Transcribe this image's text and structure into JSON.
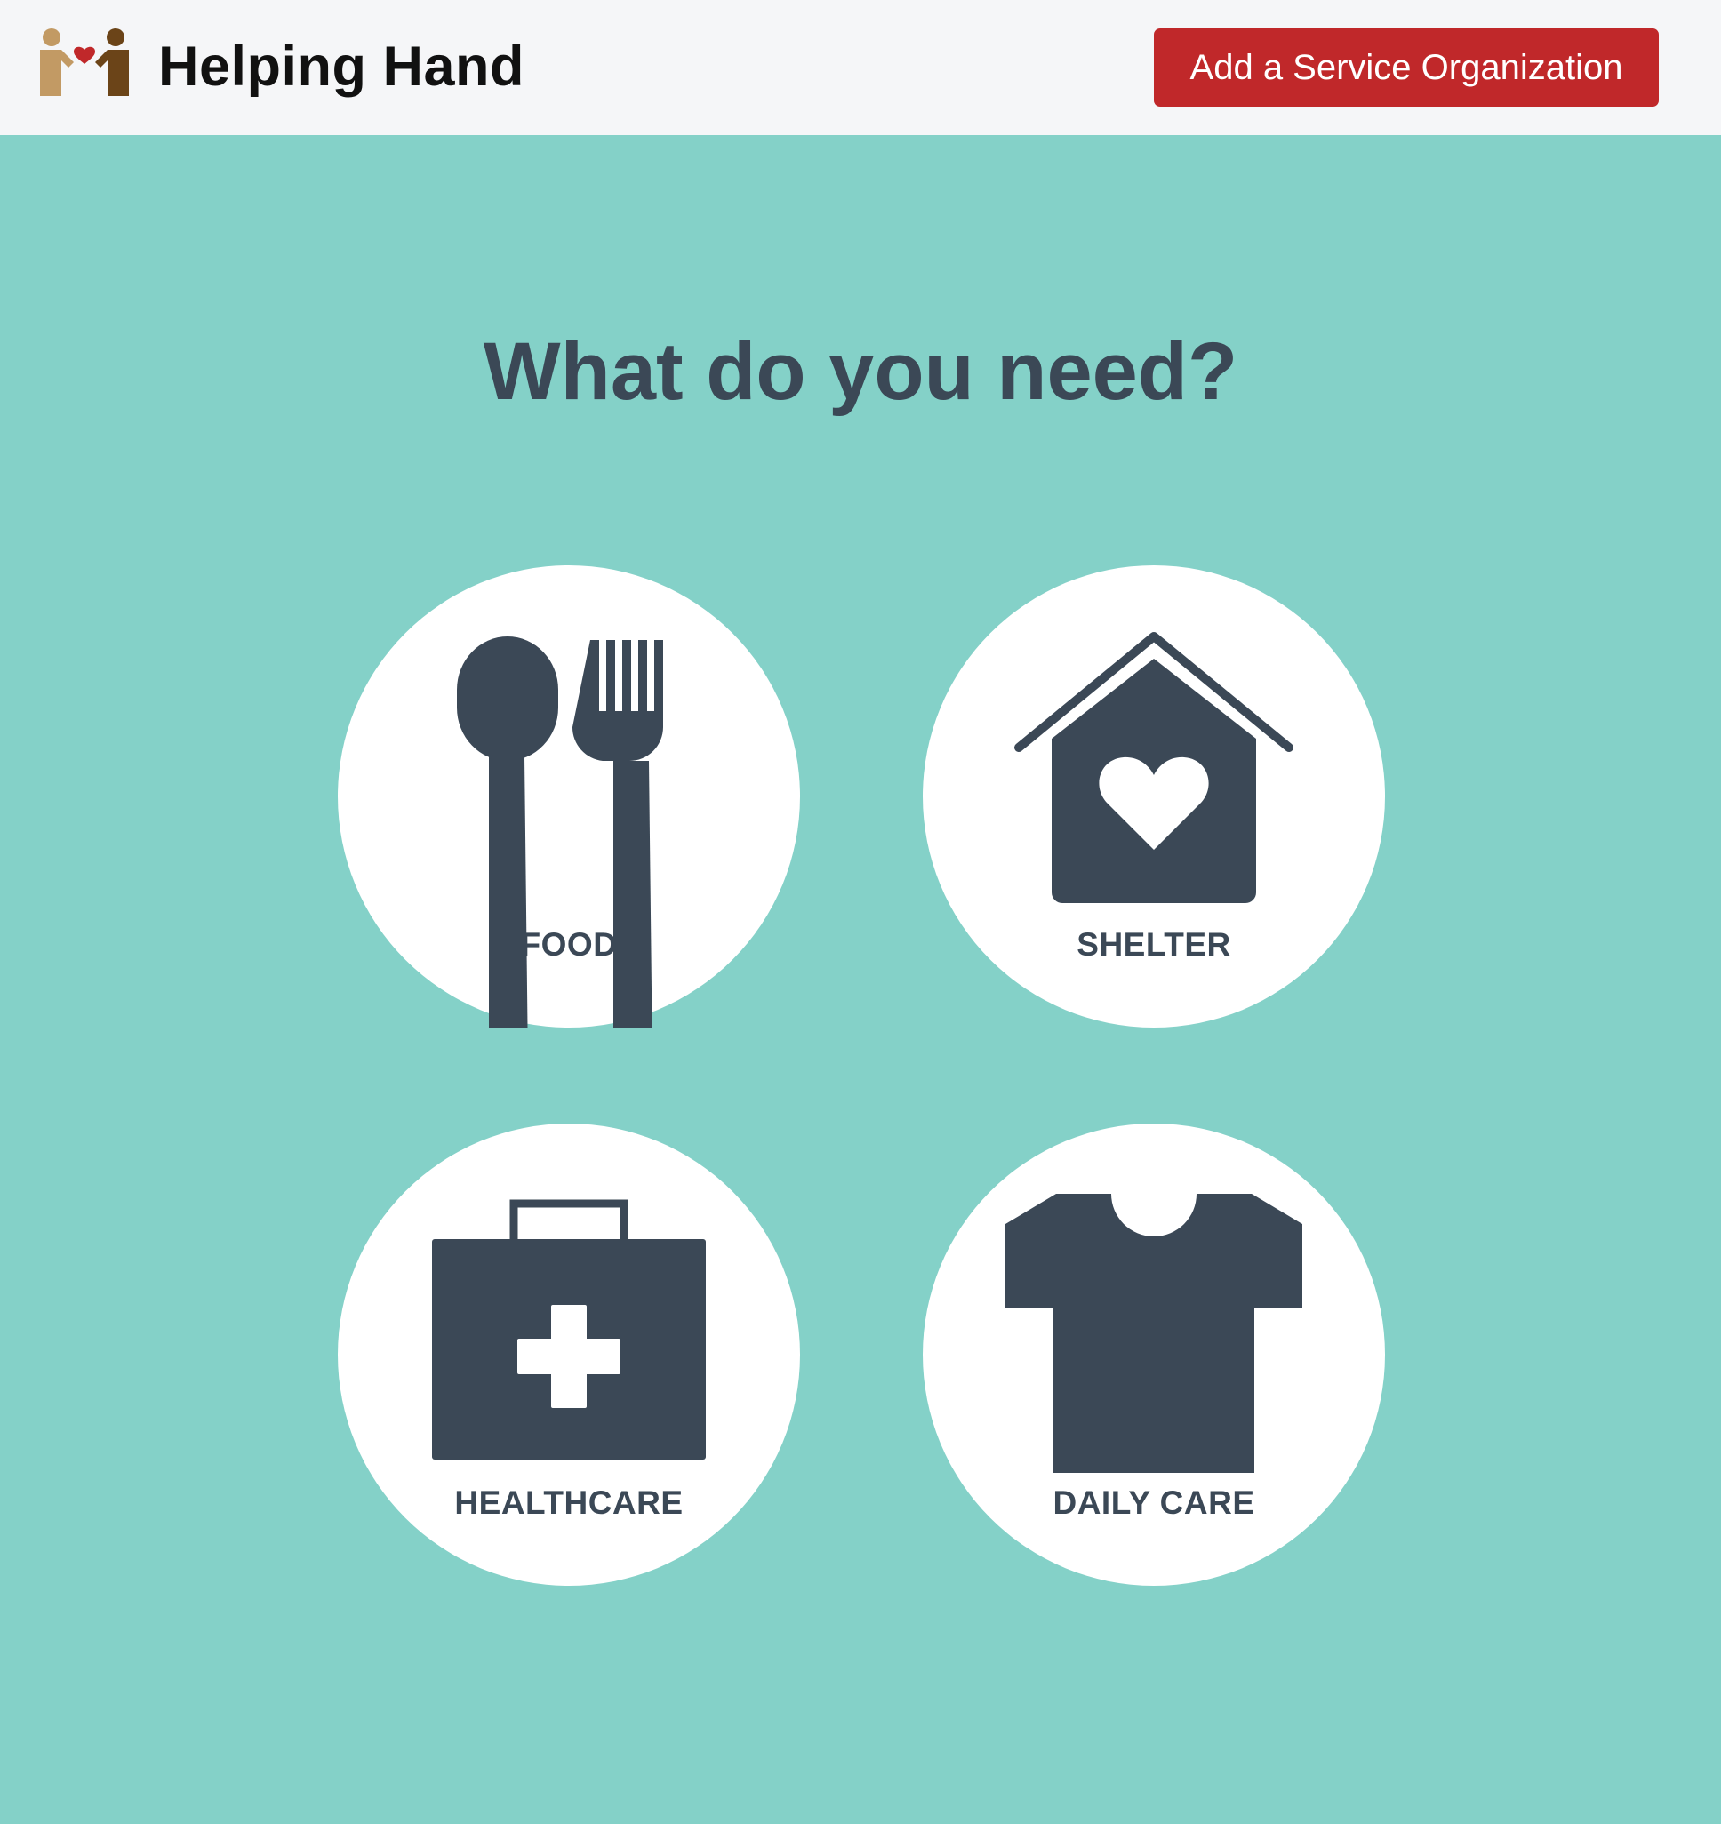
{
  "header": {
    "brand_name": "Helping Hand",
    "logo_icon": "people-heart-logo",
    "add_button_label": "Add a Service Organization"
  },
  "main": {
    "title": "What do you need?",
    "categories": [
      {
        "label": "FOOD",
        "icon": "utensils-icon"
      },
      {
        "label": "SHELTER",
        "icon": "house-heart-icon"
      },
      {
        "label": "HEALTHCARE",
        "icon": "medical-kit-icon"
      },
      {
        "label": "DAILY CARE",
        "icon": "tshirt-icon"
      }
    ]
  },
  "colors": {
    "background": "#84d1c8",
    "header_bg": "#f5f6f8",
    "accent_button": "#c0282a",
    "icon_dark": "#3b4856",
    "tile_bg": "#ffffff",
    "heart_red": "#c0282a",
    "logo_light_person": "#c29a64",
    "logo_dark_person": "#6b4418"
  }
}
